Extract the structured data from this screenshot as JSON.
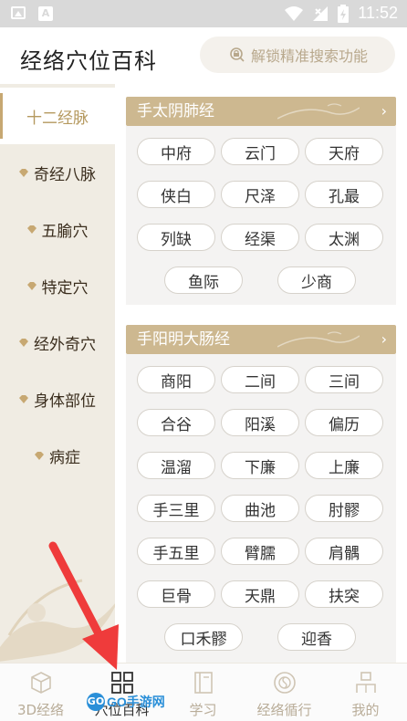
{
  "status_bar": {
    "time": "11:52",
    "left_icons": [
      "image-icon",
      "a-icon"
    ],
    "right_icons": [
      "wifi-icon",
      "signal-icon",
      "battery-icon"
    ]
  },
  "header": {
    "title": "经络穴位百科",
    "unlock_button_label": "解锁精准搜索功能",
    "unlock_icon": "search-lock-icon"
  },
  "sidebar": {
    "items": [
      {
        "label": "十二经脉",
        "active": true
      },
      {
        "label": "奇经八脉",
        "active": false
      },
      {
        "label": "五腧穴",
        "active": false
      },
      {
        "label": "特定穴",
        "active": false
      },
      {
        "label": "经外奇穴",
        "active": false
      },
      {
        "label": "身体部位",
        "active": false
      },
      {
        "label": "病症",
        "active": false
      }
    ]
  },
  "sections": [
    {
      "title": "手太阴肺经",
      "points": [
        "中府",
        "云门",
        "天府",
        "侠白",
        "尺泽",
        "孔最",
        "列缺",
        "经渠",
        "太渊",
        "鱼际",
        "少商"
      ]
    },
    {
      "title": "手阳明大肠经",
      "points": [
        "商阳",
        "二间",
        "三间",
        "合谷",
        "阳溪",
        "偏历",
        "温溜",
        "下廉",
        "上廉",
        "手三里",
        "曲池",
        "肘髎",
        "手五里",
        "臂臑",
        "肩髃",
        "巨骨",
        "天鼎",
        "扶突",
        "口禾髎",
        "迎香"
      ]
    }
  ],
  "bottom_nav": {
    "items": [
      {
        "label": "3D经络",
        "icon": "cube-icon",
        "active": false
      },
      {
        "label": "穴位百科",
        "icon": "grid-icon",
        "active": true
      },
      {
        "label": "学习",
        "icon": "book-icon",
        "active": false
      },
      {
        "label": "经络循行",
        "icon": "yin-yang-icon",
        "active": false
      },
      {
        "label": "我的",
        "icon": "person-icon",
        "active": false
      }
    ]
  },
  "watermark": {
    "circle_text": "GO",
    "text": "GO手游网"
  },
  "colors": {
    "accent_gold": "#cdb890",
    "active_text": "#b5995f",
    "sidebar_bg": "#f0ece3",
    "section_bg": "#f4f3f2",
    "arrow_red": "#ef3b3b"
  }
}
